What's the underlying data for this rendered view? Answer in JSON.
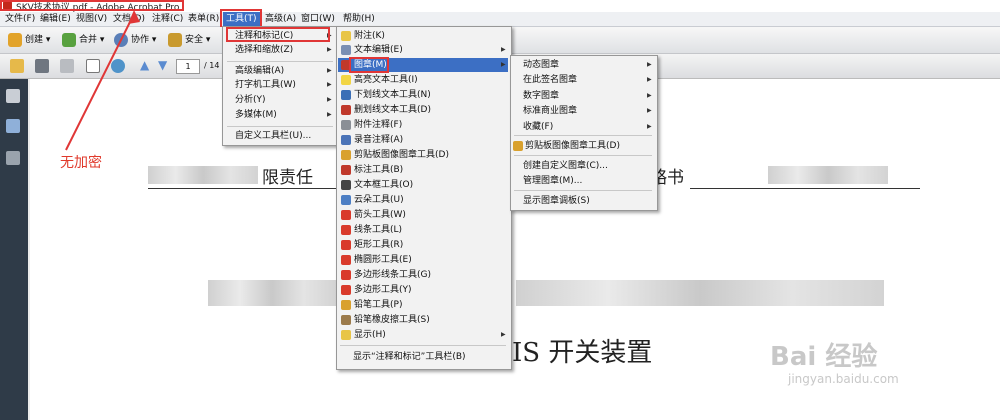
{
  "window": {
    "title": "SKV技术协议.pdf - Adobe Acrobat Pro"
  },
  "menubar": [
    {
      "label": "文件(F)",
      "name": "menu-file"
    },
    {
      "label": "编辑(E)",
      "name": "menu-edit"
    },
    {
      "label": "视图(V)",
      "name": "menu-view"
    },
    {
      "label": "文档(D)",
      "name": "menu-document"
    },
    {
      "label": "注释(C)",
      "name": "menu-comments"
    },
    {
      "label": "表单(R)",
      "name": "menu-forms"
    },
    {
      "label": "工具(T)",
      "name": "menu-tools"
    },
    {
      "label": "高级(A)",
      "name": "menu-advanced"
    },
    {
      "label": "窗口(W)",
      "name": "menu-window"
    },
    {
      "label": "帮助(H)",
      "name": "menu-help"
    }
  ],
  "toolbar1": {
    "create": "创建",
    "combine": "合并",
    "collaborate": "协作",
    "secure": "安全"
  },
  "toolbar2": {
    "page_current": "1",
    "page_total": "/ 14"
  },
  "tools_menu": {
    "items": [
      "注释和标记(C)",
      "选择和缩放(Z)",
      "高级编辑(A)",
      "打字机工具(W)",
      "分析(Y)",
      "多媒体(M)",
      "自定义工具栏(U)..."
    ]
  },
  "comment_menu": {
    "items": [
      "附注(K)",
      "文本编辑(E)",
      "图章(M)",
      "高亮文本工具(I)",
      "下划线文本工具(N)",
      "删划线文本工具(D)",
      "附件注释(F)",
      "录音注释(A)",
      "剪贴板图像图章工具(D)",
      "标注工具(B)",
      "文本框工具(O)",
      "云朵工具(U)",
      "箭头工具(W)",
      "线条工具(L)",
      "矩形工具(R)",
      "椭圆形工具(E)",
      "多边形线条工具(G)",
      "多边形工具(Y)",
      "铅笔工具(P)",
      "铅笔橡皮擦工具(S)",
      "显示(H)",
      "显示“注释和标记”工具栏(B)"
    ]
  },
  "stamp_menu": {
    "items": [
      "动态图章",
      "在此签名图章",
      "数字图章",
      "标准商业图章",
      "收藏(F)",
      "剪贴板图像图章工具(D)",
      "创建自定义图章(C)...",
      "管理图章(M)...",
      "显示图章调板(S)"
    ]
  },
  "annotation": {
    "text": "无加密",
    "color": "#e0392b"
  },
  "document": {
    "line1_left": "限责任",
    "line1_right": "略书",
    "heading": "IS 开关装置"
  },
  "watermark": {
    "brand": "Bai 经验",
    "url": "jingyan.baidu.com"
  },
  "colors": {
    "highlight": "#3c6fc4",
    "annotation_red": "#e03636",
    "panel": "#2f3b48"
  }
}
